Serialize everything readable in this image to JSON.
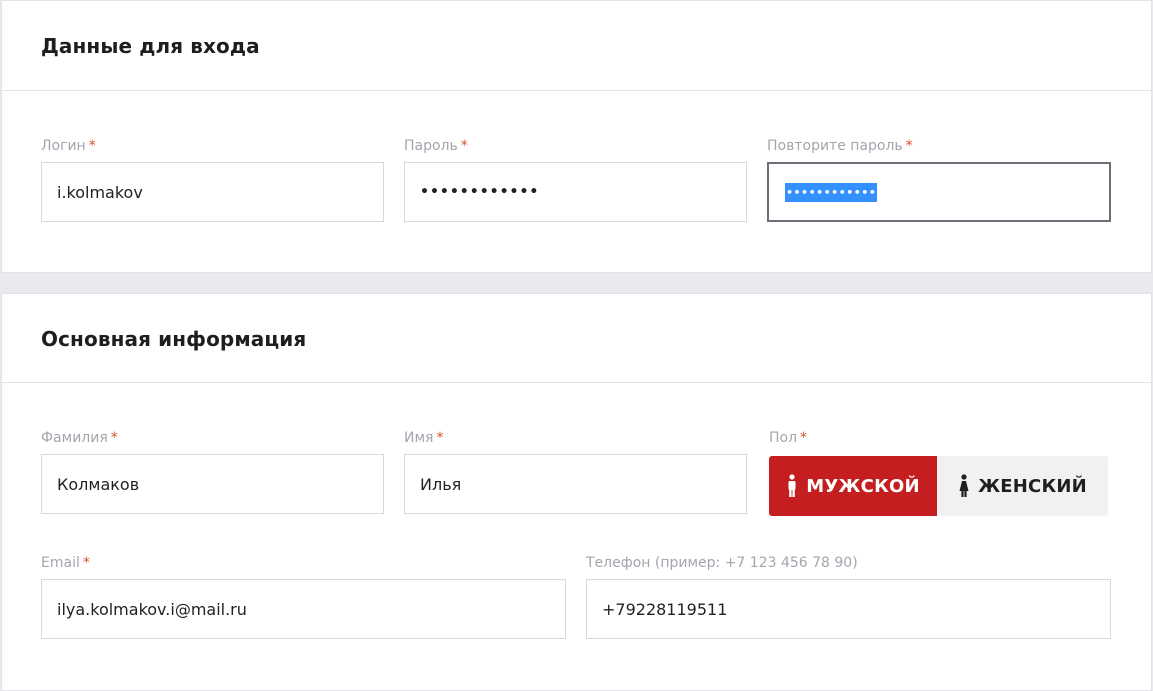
{
  "login_section": {
    "title": "Данные для входа",
    "login": {
      "label": "Логин",
      "required": "*",
      "value": "i.kolmakov"
    },
    "password": {
      "label": "Пароль",
      "required": "*",
      "value": "••••••••••••"
    },
    "password_repeat": {
      "label": "Повторите пароль",
      "required": "*",
      "value": "••••••••••••"
    }
  },
  "main_section": {
    "title": "Основная информация",
    "last_name": {
      "label": "Фамилия",
      "required": "*",
      "value": "Колмаков"
    },
    "first_name": {
      "label": "Имя",
      "required": "*",
      "value": "Илья"
    },
    "gender": {
      "label": "Пол",
      "required": "*",
      "male": "МУЖСКОЙ",
      "female": "ЖЕНСКИЙ",
      "selected": "male"
    },
    "email": {
      "label": "Email",
      "required": "*",
      "value": "ilya.kolmakov.i@mail.ru"
    },
    "phone": {
      "label": "Телефон (пример: +7 123 456 78 90)",
      "value": "+79228119511"
    }
  },
  "colors": {
    "accent_red": "#c41e20",
    "required_mark": "#d9502e",
    "selection_blue": "#3390ff"
  }
}
